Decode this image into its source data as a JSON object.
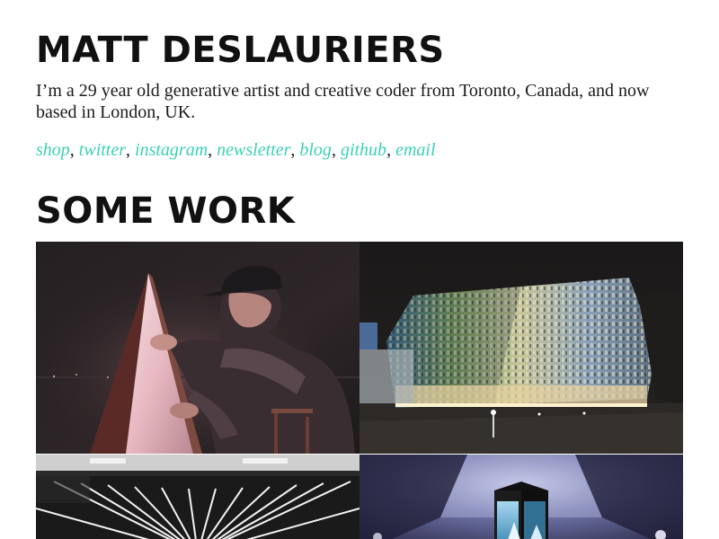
{
  "header": {
    "title": "Matt DesLauriers"
  },
  "intro": {
    "bio": "I’m a 29 year old generative artist and creative coder from Toronto, Canada, and now based in London, UK."
  },
  "links": {
    "items": [
      {
        "label": "shop"
      },
      {
        "label": "twitter"
      },
      {
        "label": "instagram"
      },
      {
        "label": "newsletter"
      },
      {
        "label": "blog"
      },
      {
        "label": "github"
      },
      {
        "label": "email"
      }
    ],
    "separator": ", ",
    "color": "#3cd0b5"
  },
  "work": {
    "heading": "Some Work"
  }
}
